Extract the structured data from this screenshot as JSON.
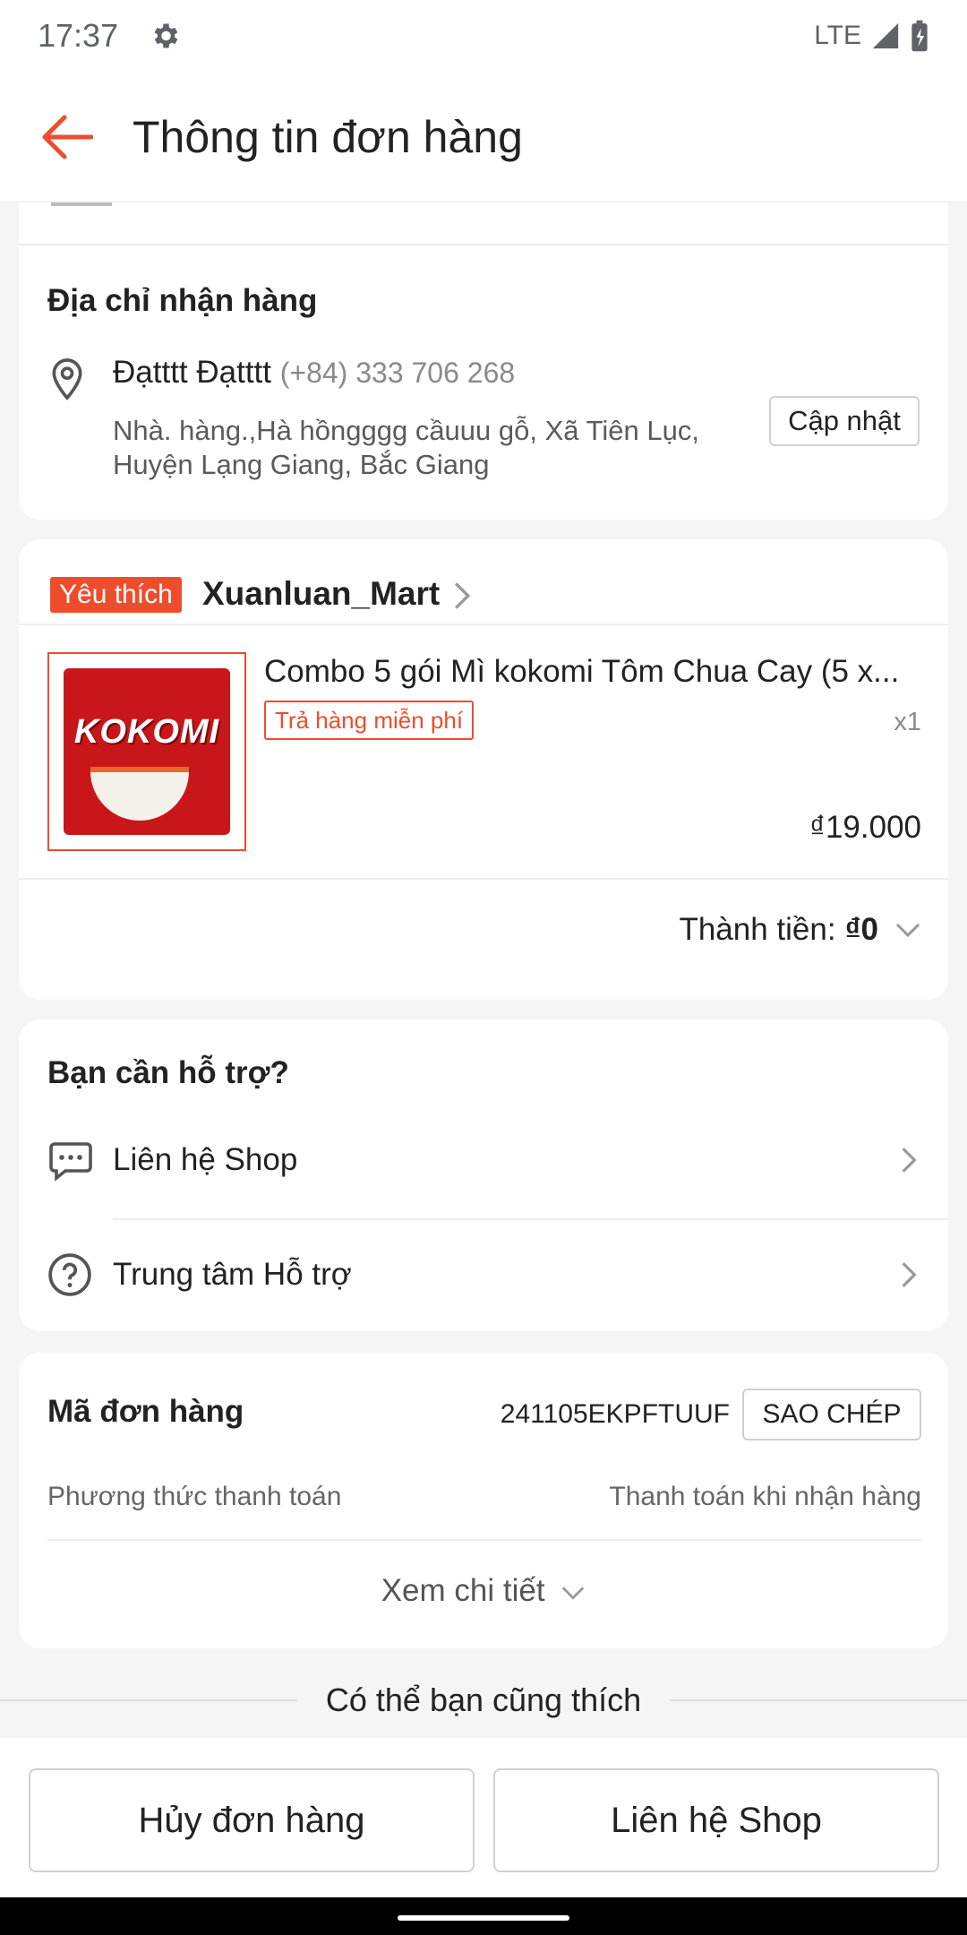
{
  "status_bar": {
    "time": "17:37",
    "network": "LTE"
  },
  "header": {
    "title": "Thông tin đơn hàng"
  },
  "address": {
    "section_title": "Địa chỉ nhận hàng",
    "name": "Đạtttt Đạtttt",
    "phone": "(+84) 333 706 268",
    "street": "Nhà. hàng.,Hà hồngggg cầuuu gỗ, Xã Tiên Lục, Huyện Lạng Giang, Bắc Giang",
    "update_button": "Cập nhật"
  },
  "shop": {
    "badge": "Yêu thích",
    "name": "Xuanluan_Mart",
    "product": {
      "image_brand": "KOKOMI",
      "name": "Combo 5 gói Mì kokomi Tôm Chua Cay (5 x...",
      "return_tag": "Trả hàng miễn phí",
      "quantity": "x1",
      "price": "₫19.000"
    },
    "total_label": "Thành tiền:",
    "total_value": "₫0"
  },
  "support": {
    "section_title": "Bạn cần hỗ trợ?",
    "items": [
      {
        "label": "Liên hệ Shop",
        "icon": "chat-icon"
      },
      {
        "label": "Trung tâm Hỗ trợ",
        "icon": "help-icon"
      }
    ]
  },
  "order": {
    "code_label": "Mã đơn hàng",
    "code": "241105EKPFTUUF",
    "copy_button": "SAO CHÉP",
    "payment_label": "Phương thức thanh toán",
    "payment_value": "Thanh toán khi nhận hàng",
    "more_label": "Xem chi tiết"
  },
  "suggest": {
    "label": "Có thể bạn cũng thích"
  },
  "bottom_bar": {
    "cancel": "Hủy đơn hàng",
    "contact": "Liên hệ Shop"
  },
  "colors": {
    "accent": "#ee4d2d",
    "background": "#f5f5f5"
  }
}
